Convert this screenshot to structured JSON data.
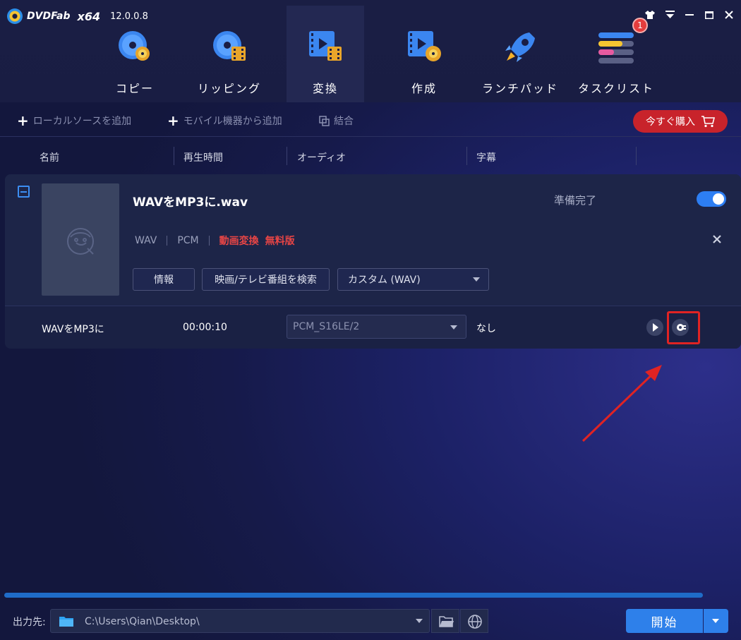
{
  "app": {
    "logo_text": "DVDFab",
    "edition": "x64",
    "version": "12.0.0.8",
    "notification_count": "1"
  },
  "nav": {
    "items": [
      {
        "label": "コピー",
        "icon": "copy-disc-icon"
      },
      {
        "label": "リッピング",
        "icon": "ripper-icon"
      },
      {
        "label": "変換",
        "icon": "converter-icon"
      },
      {
        "label": "作成",
        "icon": "creator-icon"
      },
      {
        "label": "ランチパッド",
        "icon": "rocket-icon"
      },
      {
        "label": "タスクリスト",
        "icon": "task-list-icon"
      }
    ],
    "active": "変換"
  },
  "toolbar": {
    "add_local": "ローカルソースを追加",
    "add_mobile": "モバイル機器から追加",
    "merge": "結合",
    "buy": "今すぐ購入"
  },
  "columns": [
    "名前",
    "再生時間",
    "オーディオ",
    "字幕"
  ],
  "task": {
    "title": "WAVをMP3に.wav",
    "status": "準備完了",
    "format": "WAV",
    "codec": "PCM",
    "label_convert": "動画変換",
    "label_free": "無料版",
    "btn_info": "情報",
    "btn_search": "映画/テレビ番組を検索",
    "profile": "カスタム (WAV)",
    "row": {
      "name": "WAVをMP3に",
      "duration": "00:00:10",
      "audio": "PCM_S16LE/2",
      "subtitle": "なし"
    }
  },
  "bottom": {
    "output_label": "出力先:",
    "output_path": "C:\\Users\\Qian\\Desktop\\",
    "start": "開始"
  },
  "colors": {
    "accent": "#2e80ea",
    "buy": "#c8232b",
    "free_label": "#e84545",
    "highlight": "#e02323"
  }
}
